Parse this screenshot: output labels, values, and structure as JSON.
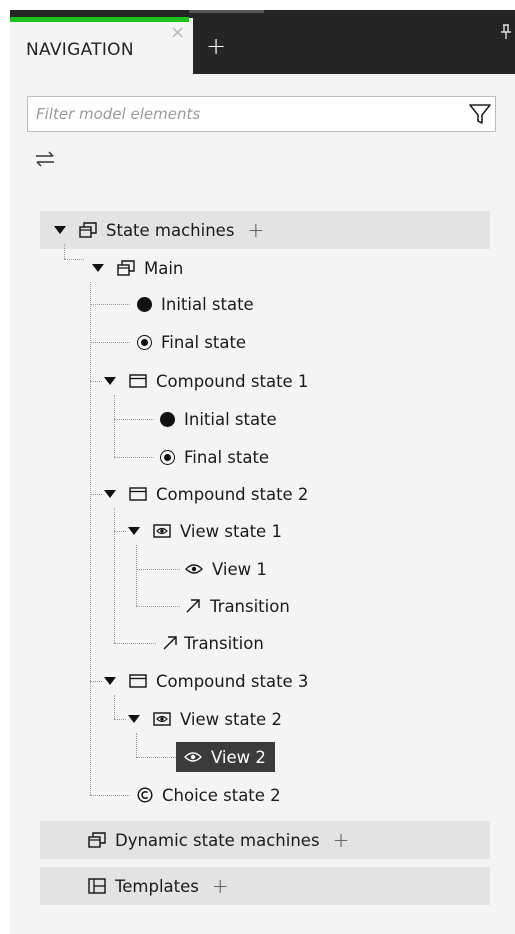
{
  "tab": {
    "label": "NAVIGATION",
    "close": "×",
    "add": "+",
    "pin": "⚲"
  },
  "filter": {
    "placeholder": "Filter model elements",
    "value": ""
  },
  "tree": {
    "state_machines": "State machines",
    "main": "Main",
    "main_initial": "Initial state",
    "main_final": "Final state",
    "compound1": "Compound state 1",
    "c1_initial": "Initial state",
    "c1_final": "Final state",
    "compound2": "Compound state 2",
    "view_state1": "View state 1",
    "view1": "View 1",
    "vs1_transition": "Transition",
    "c2_transition": "Transition",
    "compound3": "Compound state 3",
    "view_state2": "View state 2",
    "view2": "View 2",
    "choice2": "Choice state 2",
    "dynamic": "Dynamic state machines",
    "templates": "Templates",
    "add": "+"
  },
  "colors": {
    "accent_green": "#1ec21e",
    "selection": "#3b3b3b"
  }
}
